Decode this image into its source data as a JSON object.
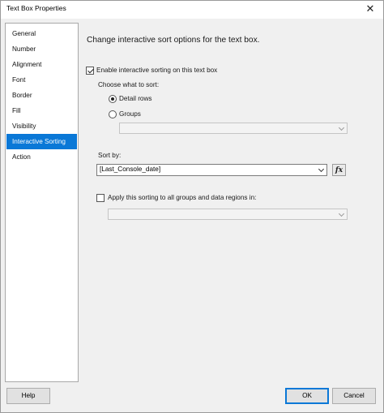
{
  "window": {
    "title": "Text Box Properties",
    "close_glyph": "✕"
  },
  "sidebar": {
    "items": [
      {
        "label": "General"
      },
      {
        "label": "Number"
      },
      {
        "label": "Alignment"
      },
      {
        "label": "Font"
      },
      {
        "label": "Border"
      },
      {
        "label": "Fill"
      },
      {
        "label": "Visibility"
      },
      {
        "label": "Interactive Sorting",
        "selected": true
      },
      {
        "label": "Action"
      }
    ]
  },
  "main": {
    "heading": "Change interactive sort options for the text box.",
    "enable_sorting_label": "Enable interactive sorting on this text box",
    "enable_sorting_checked": true,
    "choose_label": "Choose what to sort:",
    "detail_rows_label": "Detail rows",
    "detail_rows_selected": true,
    "groups_label": "Groups",
    "groups_selected": false,
    "groups_combo_value": "",
    "sort_by_label": "Sort by:",
    "sort_by_value": "[Last_Console_date]",
    "fx_label": "fx",
    "apply_all_label": "Apply this sorting to all groups and data regions in:",
    "apply_all_checked": false,
    "apply_all_combo_value": ""
  },
  "footer": {
    "help_label": "Help",
    "ok_label": "OK",
    "cancel_label": "Cancel"
  },
  "colors": {
    "selection": "#0a78d7",
    "background": "#f0f0f0"
  }
}
